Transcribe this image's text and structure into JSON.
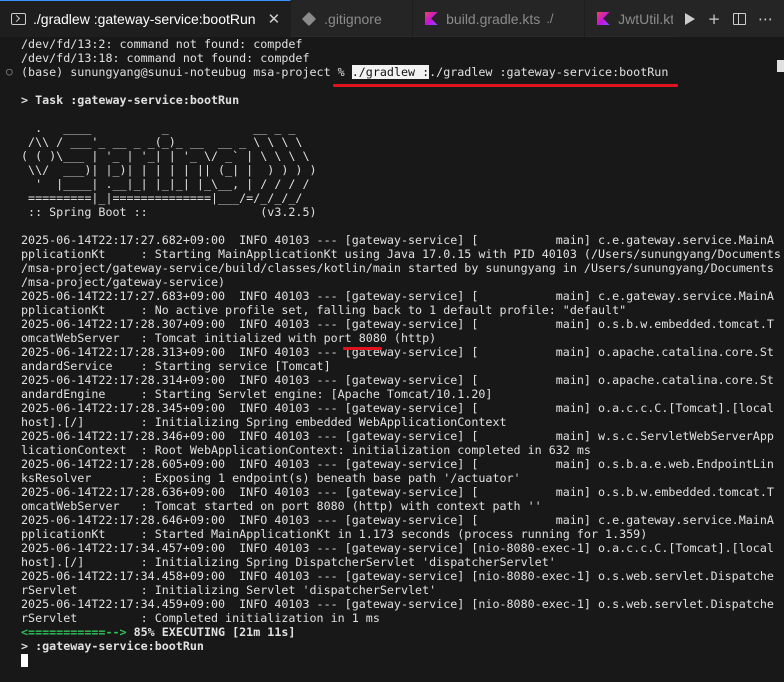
{
  "tabs": [
    {
      "label": "./gradlew :gateway-service:bootRun",
      "icon": "terminal-icon",
      "active": true,
      "close": "✕"
    },
    {
      "label": ".gitignore",
      "icon": "git-icon",
      "active": false
    },
    {
      "label": "build.gradle.kts",
      "desc": "./",
      "icon": "kotlin-icon",
      "active": false
    },
    {
      "label": "JwtUtil.kt",
      "icon": "kotlin-icon",
      "active": false
    }
  ],
  "actions": {
    "add": "+"
  },
  "terminal": {
    "lines": [
      "/dev/fd/13:2: command not found: compdef",
      "/dev/fd/13:18: command not found: compdef"
    ],
    "prompt": {
      "env": "(base) sunungyang@sunui-noteubug msa-project % ",
      "selected": "./gradlew :",
      "rest": "./gradlew :gateway-service:bootRun"
    },
    "task": "> Task :gateway-service:bootRun",
    "banner": [
      "  .   ____          _            __ _ _",
      " /\\\\ / ___'_ __ _ _(_)_ __  __ _ \\ \\ \\ \\",
      "( ( )\\___ | '_ | '_| | '_ \\/ _` | \\ \\ \\ \\",
      " \\\\/  ___)| |_)| | | | | || (_| |  ) ) ) )",
      "  '  |____| .__|_| |_|_| |_\\__, | / / / /",
      " =========|_|==============|___/=/_/_/_/",
      " :: Spring Boot ::                (v3.2.5)"
    ],
    "log": [
      "2025-06-14T22:17:27.682+09:00  INFO 40103 --- [gateway-service] [           main] c.e.gateway.service.MainA",
      "pplicationKt     : Starting MainApplicationKt using Java 17.0.15 with PID 40103 (/Users/sunungyang/Documents",
      "/msa-project/gateway-service/build/classes/kotlin/main started by sunungyang in /Users/sunungyang/Documents",
      "/msa-project/gateway-service)",
      "2025-06-14T22:17:27.683+09:00  INFO 40103 --- [gateway-service] [           main] c.e.gateway.service.MainA",
      "pplicationKt     : No active profile set, falling back to 1 default profile: \"default\"",
      "2025-06-14T22:17:28.307+09:00  INFO 40103 --- [gateway-service] [           main] o.s.b.w.embedded.tomcat.T",
      "omcatWebServer   : Tomcat initialized with port 8080 (http)",
      "2025-06-14T22:17:28.313+09:00  INFO 40103 --- [gateway-service] [           main] o.apache.catalina.core.St",
      "andardService    : Starting service [Tomcat]",
      "2025-06-14T22:17:28.314+09:00  INFO 40103 --- [gateway-service] [           main] o.apache.catalina.core.St",
      "andardEngine     : Starting Servlet engine: [Apache Tomcat/10.1.20]",
      "2025-06-14T22:17:28.345+09:00  INFO 40103 --- [gateway-service] [           main] o.a.c.c.C.[Tomcat].[local",
      "host].[/]        : Initializing Spring embedded WebApplicationContext",
      "2025-06-14T22:17:28.346+09:00  INFO 40103 --- [gateway-service] [           main] w.s.c.ServletWebServerApp",
      "licationContext  : Root WebApplicationContext: initialization completed in 632 ms",
      "2025-06-14T22:17:28.605+09:00  INFO 40103 --- [gateway-service] [           main] o.s.b.a.e.web.EndpointLin",
      "ksResolver       : Exposing 1 endpoint(s) beneath base path '/actuator'",
      "2025-06-14T22:17:28.636+09:00  INFO 40103 --- [gateway-service] [           main] o.s.b.w.embedded.tomcat.T",
      "omcatWebServer   : Tomcat started on port 8080 (http) with context path ''",
      "2025-06-14T22:17:28.646+09:00  INFO 40103 --- [gateway-service] [           main] c.e.gateway.service.MainA",
      "pplicationKt     : Started MainApplicationKt in 1.173 seconds (process running for 1.359)",
      "2025-06-14T22:17:34.457+09:00  INFO 40103 --- [gateway-service] [nio-8080-exec-1] o.a.c.c.C.[Tomcat].[local",
      "host].[/]        : Initializing Spring DispatcherServlet 'dispatcherServlet'",
      "2025-06-14T22:17:34.458+09:00  INFO 40103 --- [gateway-service] [nio-8080-exec-1] o.s.web.servlet.Dispatche",
      "rServlet         : Initializing Servlet 'dispatcherServlet'",
      "2025-06-14T22:17:34.459+09:00  INFO 40103 --- [gateway-service] [nio-8080-exec-1] o.s.web.servlet.Dispatche",
      "rServlet         : Completed initialization in 1 ms"
    ],
    "progress": {
      "bar": "<===========--> ",
      "text": "85% EXECUTING [21m 11s]"
    },
    "current_task": "> :gateway-service:bootRun"
  },
  "colors": {
    "underline": "#e0141e",
    "progress": "#2fc35a",
    "active_tab_border": "#3794ff"
  }
}
